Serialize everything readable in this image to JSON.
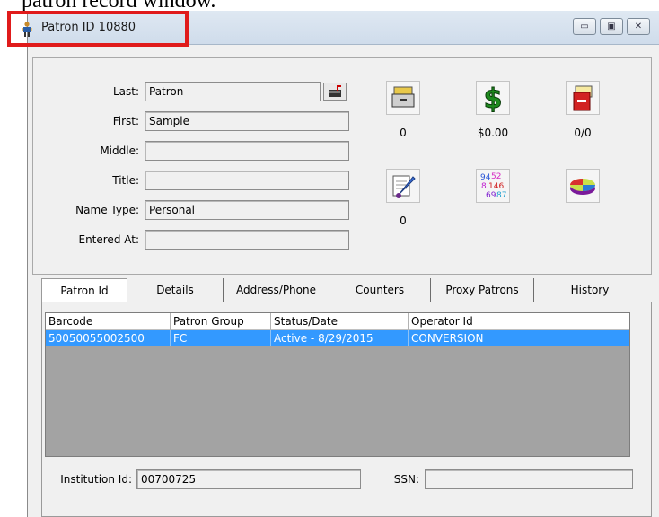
{
  "document": {
    "caption": "patron record window."
  },
  "window": {
    "title": "Patron ID 10880",
    "controls": {
      "minimize": "▭",
      "maximize": "▣",
      "close": "✕"
    }
  },
  "name_form": {
    "last_label": "Last:",
    "last_value": "Patron",
    "first_label": "First:",
    "first_value": "Sample",
    "middle_label": "Middle:",
    "middle_value": "",
    "title_label": "Title:",
    "title_value": "",
    "name_type_label": "Name Type:",
    "name_type_value": "Personal",
    "entered_at_label": "Entered At:",
    "entered_at_value": ""
  },
  "summary_icons": {
    "items_count": "0",
    "fines_amount": "$0.00",
    "holds_ratio": "0/0",
    "notes_count": "0"
  },
  "tabs": [
    {
      "label": "Patron Id"
    },
    {
      "label": "Details"
    },
    {
      "label": "Address/Phone"
    },
    {
      "label": "Counters"
    },
    {
      "label": "Proxy Patrons"
    },
    {
      "label": "History"
    }
  ],
  "barcode_table": {
    "columns": [
      "Barcode",
      "Patron Group",
      "Status/Date",
      "Operator Id"
    ],
    "rows": [
      [
        "50050055002500",
        "FC",
        "Active - 8/29/2015",
        "CONVERSION"
      ]
    ]
  },
  "footer": {
    "institution_label": "Institution Id:",
    "institution_value": "00700725",
    "ssn_label": "SSN:",
    "ssn_value": ""
  },
  "colors": {
    "selection": "#3399ff",
    "highlight_box": "#e01b1b"
  }
}
